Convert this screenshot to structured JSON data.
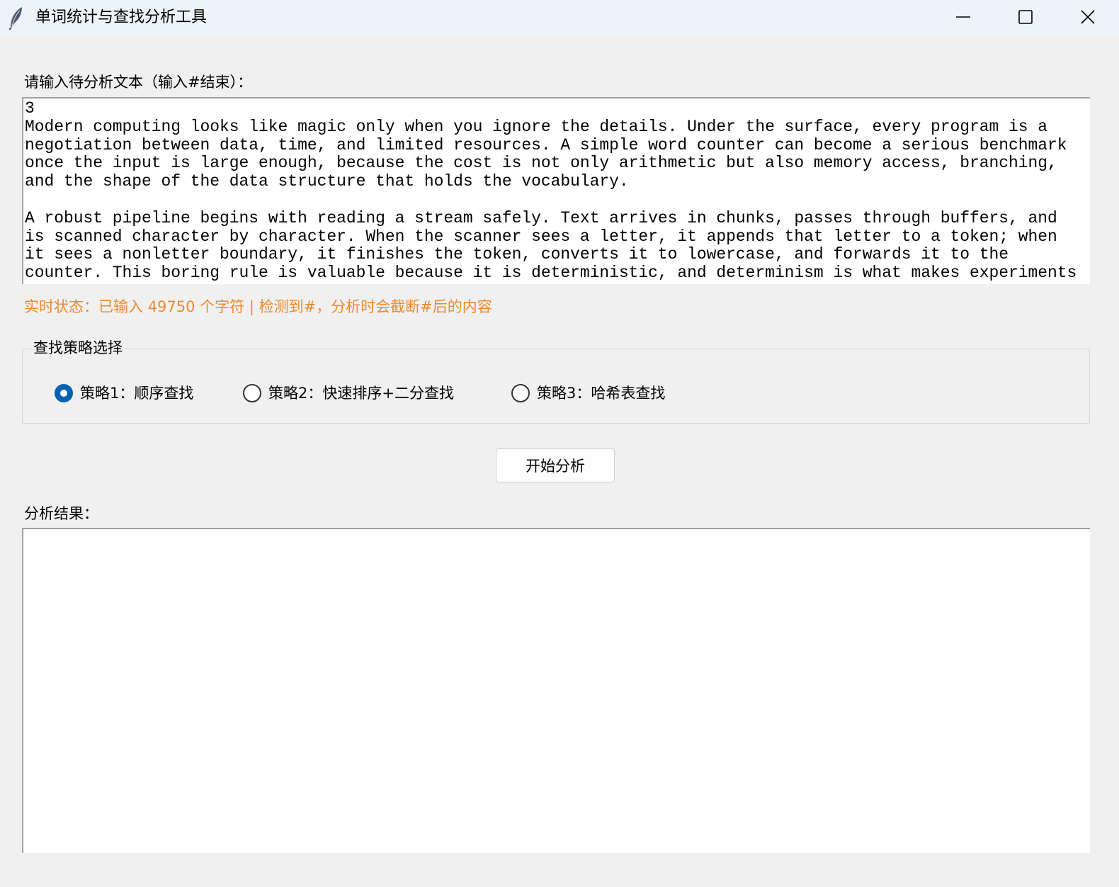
{
  "window": {
    "title": "单词统计与查找分析工具",
    "app_icon": "feather-icon",
    "controls": {
      "minimize_icon": "minimize-icon",
      "maximize_icon": "maximize-icon",
      "close_icon": "close-icon"
    }
  },
  "input": {
    "label": "请输入待分析文本（输入#结束）：",
    "text": "3\nModern computing looks like magic only when you ignore the details. Under the surface, every program is a\nnegotiation between data, time, and limited resources. A simple word counter can become a serious benchmark\nonce the input is large enough, because the cost is not only arithmetic but also memory access, branching,\nand the shape of the data structure that holds the vocabulary.\n\nA robust pipeline begins with reading a stream safely. Text arrives in chunks, passes through buffers, and\nis scanned character by character. When the scanner sees a letter, it appends that letter to a token; when\nit sees a nonletter boundary, it finishes the token, converts it to lowercase, and forwards it to the\ncounter. This boring rule is valuable because it is deterministic, and determinism is what makes experiments"
  },
  "status": {
    "text": "实时状态：已输入 49750 个字符 | 检测到#，分析时会截断#后的内容",
    "color": "#ee8a2c"
  },
  "strategy": {
    "legend": "查找策略选择",
    "options": [
      {
        "label": "策略1：顺序查找",
        "checked": true
      },
      {
        "label": "策略2：快速排序+二分查找",
        "checked": false
      },
      {
        "label": "策略3：哈希表查找",
        "checked": false
      }
    ],
    "accent_color": "#0063b1"
  },
  "actions": {
    "start_label": "开始分析"
  },
  "result": {
    "label": "分析结果：",
    "text": ""
  }
}
